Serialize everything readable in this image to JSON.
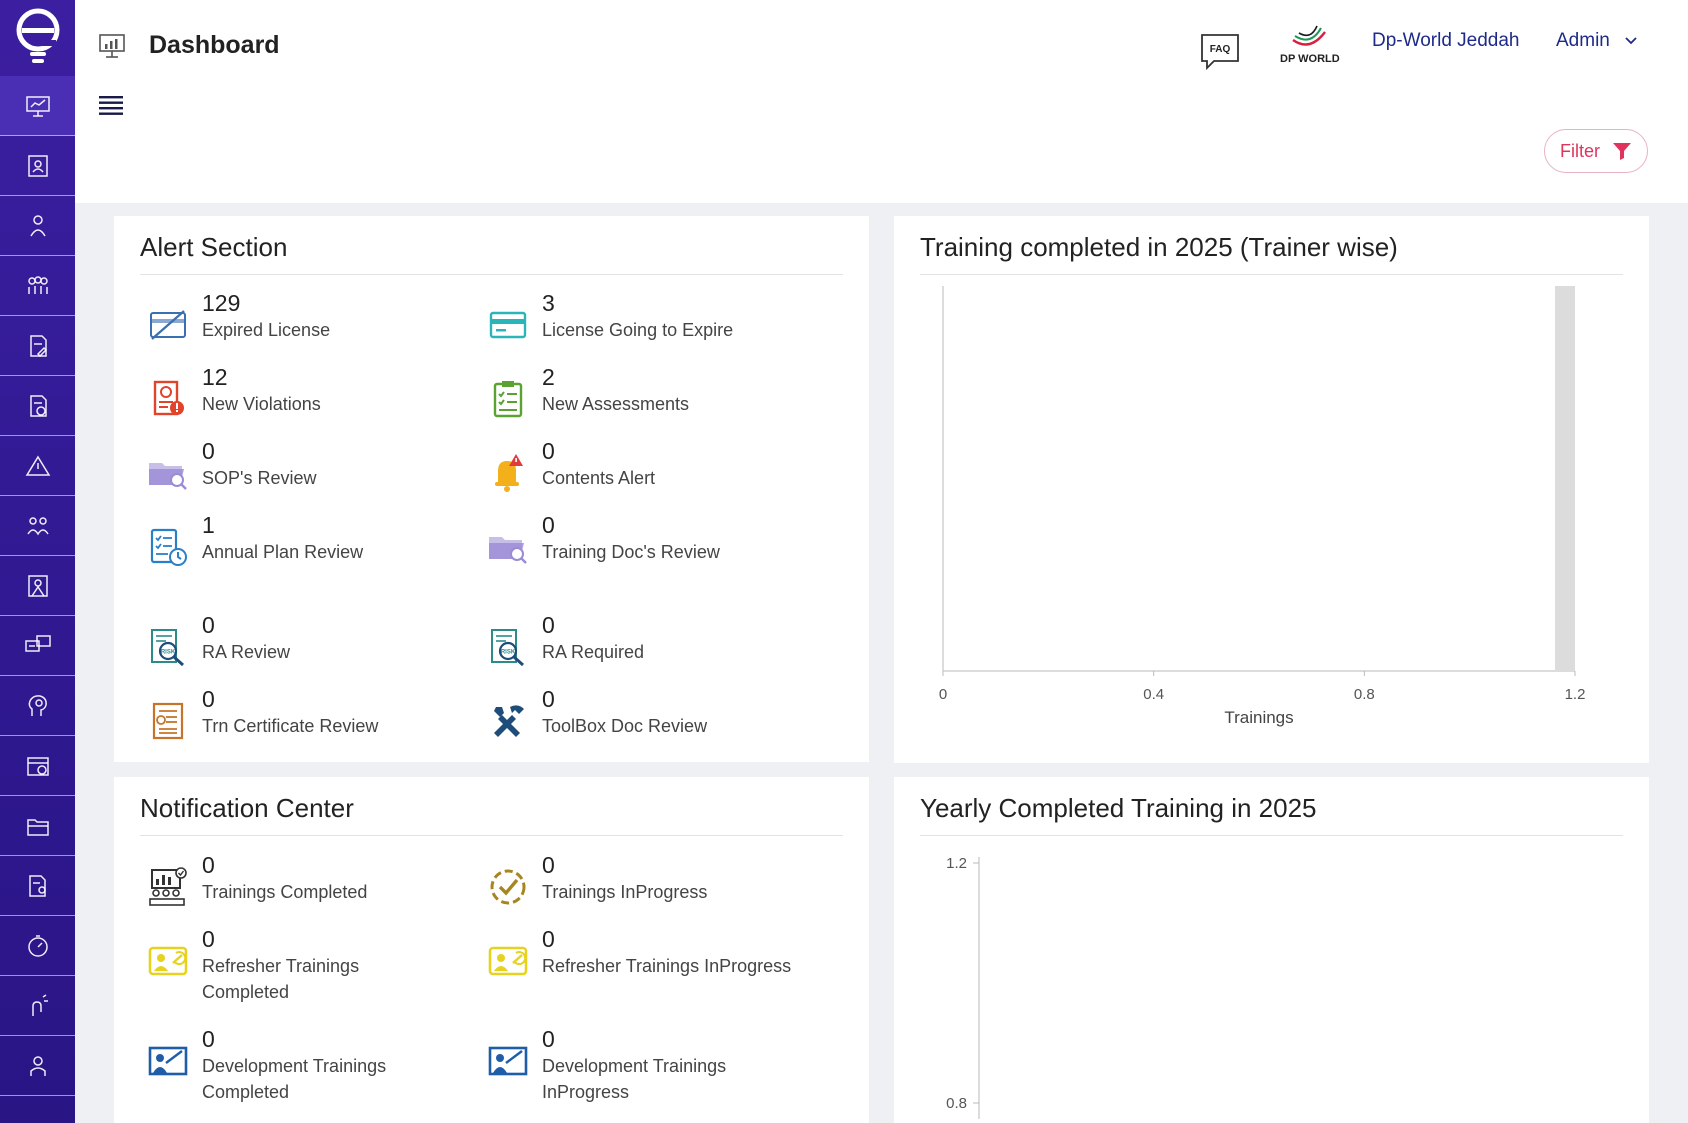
{
  "header": {
    "title": "Dashboard",
    "faq_label": "FAQ",
    "brand_label": "DP WORLD",
    "org_name": "Dp-World Jeddah",
    "user_name": "Admin",
    "filter_label": "Filter"
  },
  "sidebar": {
    "icons": [
      "dashboard-icon",
      "profile-card-icon",
      "trainer-icon",
      "people-group-icon",
      "document-edit-icon",
      "document-chart-icon",
      "warning-icon",
      "team-icon",
      "user-frame-icon",
      "chat-icon",
      "idea-head-icon",
      "calendar-icon",
      "folder-icon",
      "document-user-icon",
      "timer-icon",
      "notification-hand-icon",
      "user-icon"
    ]
  },
  "alert_section": {
    "title": "Alert Section",
    "items": [
      {
        "count": "129",
        "label": "Expired License",
        "icon": "expired-license-icon",
        "color": "#3a6fb0"
      },
      {
        "count": "3",
        "label": "License Going to Expire",
        "icon": "license-icon",
        "color": "#2bb5b8"
      },
      {
        "count": "12",
        "label": "New Violations",
        "icon": "violation-icon",
        "color": "#e0452b"
      },
      {
        "count": "2",
        "label": "New Assessments",
        "icon": "assessment-clipboard-icon",
        "color": "#5aa332"
      },
      {
        "count": "0",
        "label": "SOP's Review",
        "icon": "folder-search-icon",
        "color": "#9b8ad6"
      },
      {
        "count": "0",
        "label": "Contents Alert",
        "icon": "bell-alert-icon",
        "color": "#f3b01a"
      },
      {
        "count": "1",
        "label": "Annual Plan Review",
        "icon": "annual-plan-icon",
        "color": "#2a7fc9"
      },
      {
        "count": "0",
        "label": "Training Doc's Review",
        "icon": "folder-search-icon",
        "color": "#9b8ad6"
      },
      {
        "count": "0",
        "label": "RA Review",
        "icon": "ra-review-icon",
        "color": "#2b8a8a"
      },
      {
        "count": "0",
        "label": "RA Required",
        "icon": "ra-required-icon",
        "color": "#2b8a8a"
      },
      {
        "count": "0",
        "label": "Trn Certificate Review",
        "icon": "certificate-icon",
        "color": "#c7742a"
      },
      {
        "count": "0",
        "label": "ToolBox Doc Review",
        "icon": "tools-icon",
        "color": "#1f4d7a"
      }
    ]
  },
  "notification_center": {
    "title": "Notification Center",
    "items": [
      {
        "count": "0",
        "label": "Trainings Completed",
        "icon": "classroom-icon",
        "color": "#333333"
      },
      {
        "count": "0",
        "label": "Trainings InProgress",
        "icon": "progress-check-icon",
        "color": "#a8861f"
      },
      {
        "count": "0",
        "label": "Refresher Trainings Completed",
        "icon": "refresher-training-icon",
        "color": "#e6d21f"
      },
      {
        "count": "0",
        "label": "Refresher Trainings InProgress",
        "icon": "refresher-training-icon",
        "color": "#e6d21f"
      },
      {
        "count": "0",
        "label": "Development Trainings Completed",
        "icon": "development-training-icon",
        "color": "#1f5da8"
      },
      {
        "count": "0",
        "label": "Development Trainings InProgress",
        "icon": "development-training-icon",
        "color": "#1f5da8"
      }
    ]
  },
  "chart_data": [
    {
      "type": "bar",
      "title": "Training completed in 2025 (Trainer wise)",
      "orientation": "horizontal",
      "categories": [
        ""
      ],
      "values": [
        1.2
      ],
      "xlabel": "Trainings",
      "ylabel": "",
      "xlim": [
        0,
        1.2
      ],
      "xticks": [
        "0",
        "0.4",
        "0.8",
        "1.2"
      ],
      "grid": false,
      "bar_color": "#dcdcdc"
    },
    {
      "type": "bar",
      "title": "Yearly Completed Training in 2025",
      "categories": [],
      "values": [],
      "xlabel": "",
      "ylabel": "",
      "yticks_visible": [
        "1.2",
        "0.8"
      ],
      "grid": false
    }
  ]
}
